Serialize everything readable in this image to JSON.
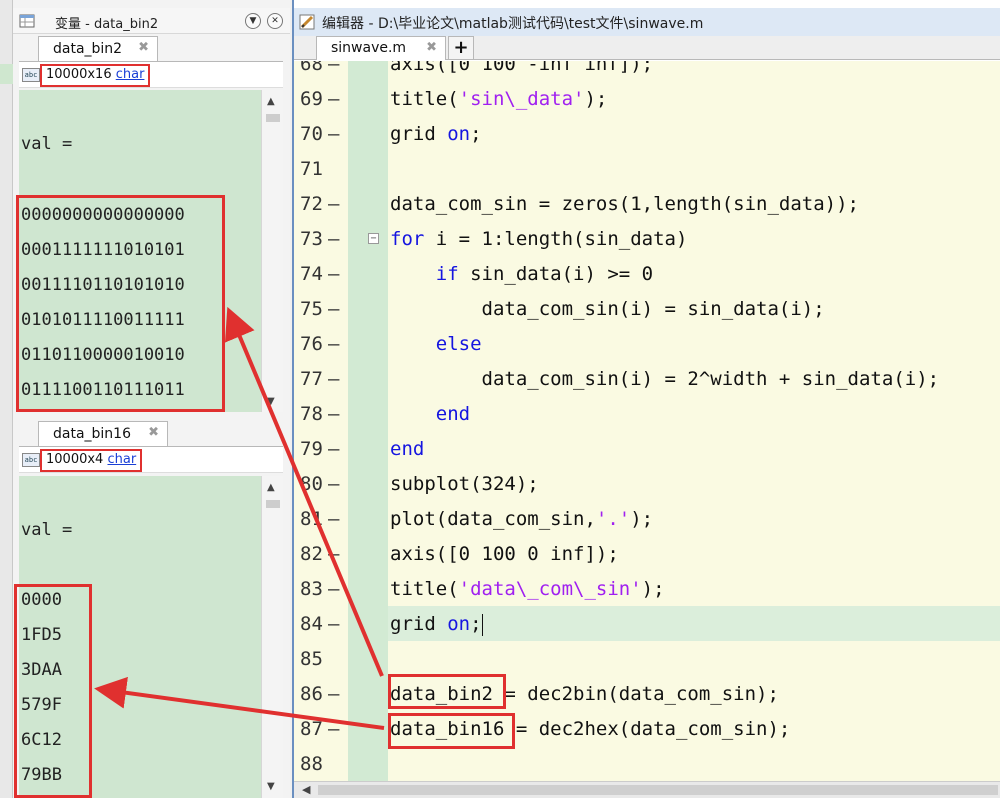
{
  "variables_panel": {
    "title": "变量 - data_bin2",
    "upper": {
      "tab_label": "data_bin2",
      "size": "10000x16",
      "type_link": "char",
      "var_label": "val =",
      "values": [
        "0000000000000000",
        "0001111111010101",
        "0011110110101010",
        "0101011110011111",
        "0110110000010010",
        "0111100110111011"
      ]
    },
    "lower": {
      "tab_label": "data_bin16",
      "size": "10000x4",
      "type_link": "char",
      "var_label": "val =",
      "values": [
        "0000",
        "1FD5",
        "3DAA",
        "579F",
        "6C12",
        "79BB"
      ]
    }
  },
  "editor": {
    "title": "编辑器 - D:\\毕业论文\\matlab测试代码\\test文件\\sinwave.m",
    "tab_label": "sinwave.m",
    "new_tab": "+",
    "lines": [
      {
        "n": "68",
        "code": "axis([0 100 -inf inf]);"
      },
      {
        "n": "69",
        "code": "title('sin\\_data');"
      },
      {
        "n": "70",
        "code": "grid on;"
      },
      {
        "n": "71",
        "code": ""
      },
      {
        "n": "72",
        "code": "data_com_sin = zeros(1,length(sin_data));"
      },
      {
        "n": "73",
        "code": "for i = 1:length(sin_data)"
      },
      {
        "n": "74",
        "code": "    if sin_data(i) >= 0"
      },
      {
        "n": "75",
        "code": "        data_com_sin(i) = sin_data(i);"
      },
      {
        "n": "76",
        "code": "    else"
      },
      {
        "n": "77",
        "code": "        data_com_sin(i) = 2^width + sin_data(i);"
      },
      {
        "n": "78",
        "code": "    end"
      },
      {
        "n": "79",
        "code": "end"
      },
      {
        "n": "80",
        "code": "subplot(324);"
      },
      {
        "n": "81",
        "code": "plot(data_com_sin,'.');"
      },
      {
        "n": "82",
        "code": "axis([0 100 0 inf]);"
      },
      {
        "n": "83",
        "code": "title('data\\_com\\_sin');"
      },
      {
        "n": "84",
        "code": "grid on;"
      },
      {
        "n": "85",
        "code": ""
      },
      {
        "n": "86",
        "code": "data_bin2 = dec2bin(data_com_sin);"
      },
      {
        "n": "87",
        "code": "data_bin16 = dec2hex(data_com_sin);"
      },
      {
        "n": "88",
        "code": ""
      }
    ]
  },
  "colors": {
    "annotation_red": "#e0302f",
    "keyword_blue": "#1515e0",
    "string_purple": "#a020f0",
    "value_bg_green": "#cfe6d0",
    "editor_bg": "#fafae2"
  }
}
